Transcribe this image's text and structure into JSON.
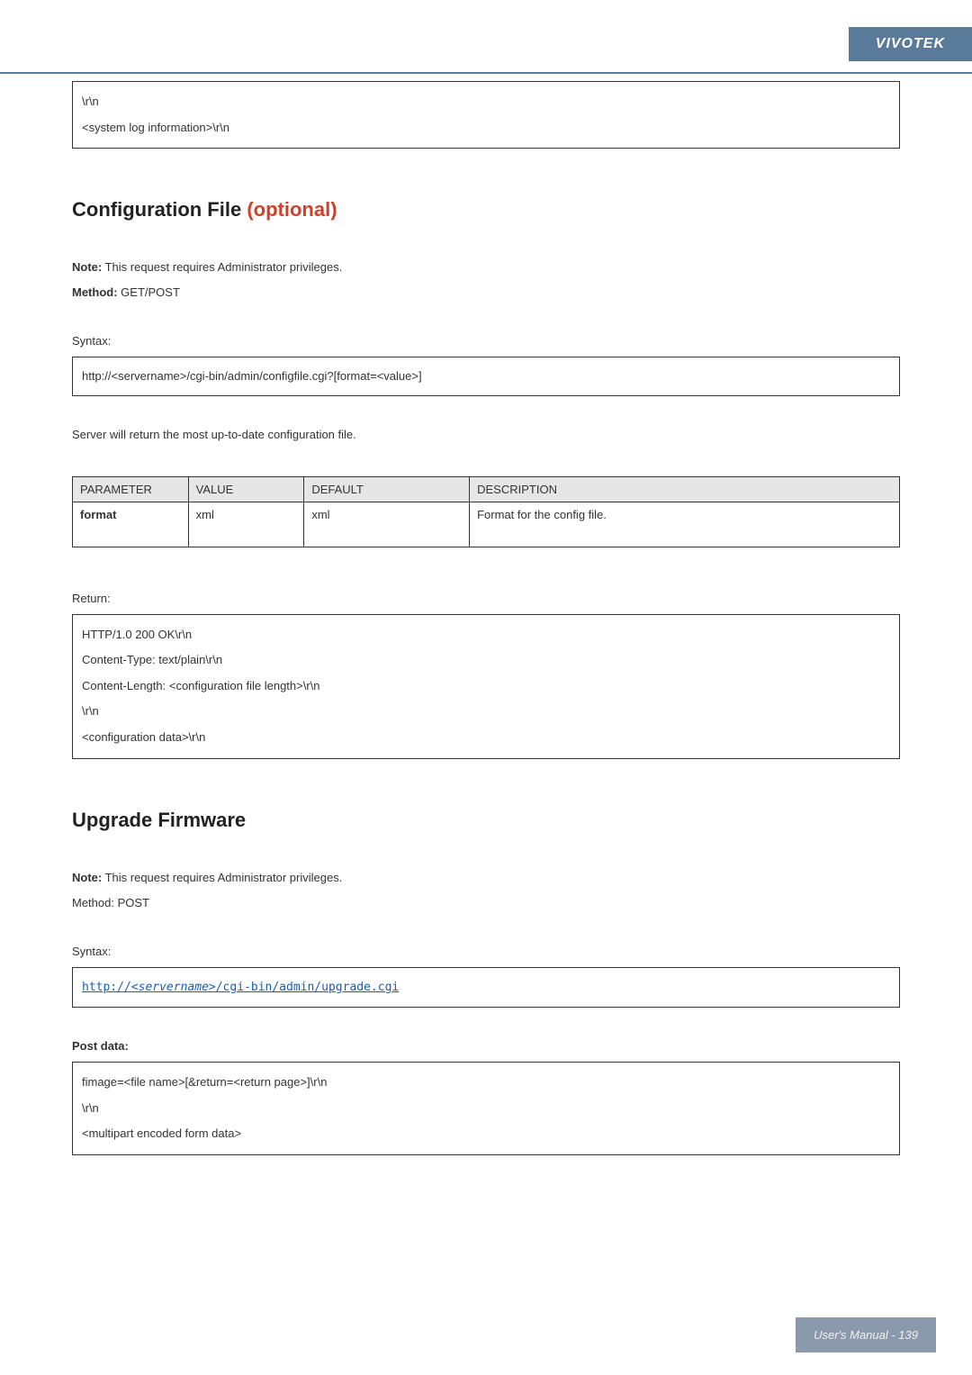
{
  "brand": "VIVOTEK",
  "top_box": {
    "line1": "\\r\\n",
    "line2": "<system log information>\\r\\n"
  },
  "section1": {
    "title": "Configuration File ",
    "optional": "(optional)",
    "note_label": "Note:",
    "note_text": " This request requires Administrator privileges.",
    "method_label": "Method:",
    "method_text": " GET/POST",
    "syntax_label": "Syntax:",
    "syntax_box": "http://<servername>/cgi-bin/admin/configfile.cgi?[format=<value>]",
    "server_text": "Server will return the most up-to-date configuration file.",
    "table": {
      "headers": {
        "c1": "PARAMETER",
        "c2": "VALUE",
        "c3": "DEFAULT",
        "c4": "DESCRIPTION"
      },
      "row": {
        "c1": "format",
        "c2": "xml",
        "c3": "xml",
        "c4": "Format for the config file."
      }
    },
    "return_label": "Return:",
    "return_box": {
      "l1": "HTTP/1.0 200 OK\\r\\n",
      "l2": "Content-Type: text/plain\\r\\n",
      "l3": "Content-Length: <configuration file length>\\r\\n",
      "l4": "\\r\\n",
      "l5": "<configuration data>\\r\\n"
    }
  },
  "section2": {
    "title": "Upgrade Firmware",
    "note_label": "Note:",
    "note_text": " This request requires Administrator privileges.",
    "method_text": "Method: POST",
    "syntax_label": "Syntax:",
    "syntax_url_prefix": "http://<",
    "syntax_url_mid": "servername",
    "syntax_url_suffix": ">/cgi-bin/admin/upgrade.cgi",
    "post_label": "Post data:",
    "post_box": {
      "l1": "fimage=<file name>[&return=<return page>]\\r\\n",
      "l2": "\\r\\n",
      "l3": "<multipart encoded form data>"
    }
  },
  "footer": "User's Manual - 139"
}
